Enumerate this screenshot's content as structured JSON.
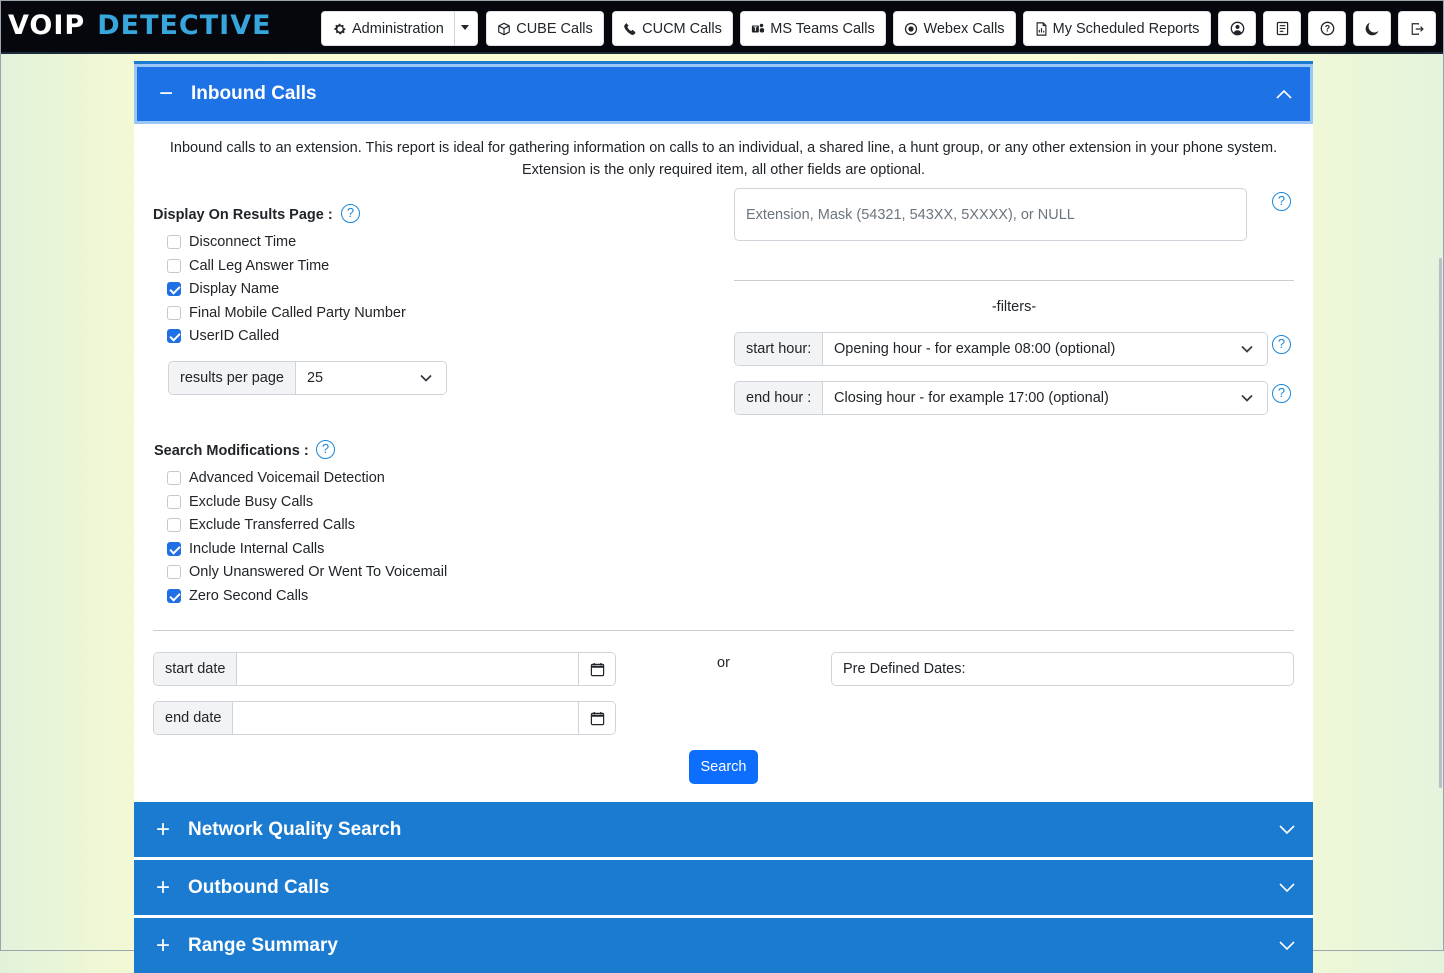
{
  "navbar": {
    "logo_voip": "VOIP",
    "logo_detective": "DETECTIVE",
    "administration": "Administration",
    "cube_calls": "CUBE Calls",
    "cucm_calls": "CUCM Calls",
    "ms_teams_calls": "MS Teams Calls",
    "webex_calls": "Webex Calls",
    "scheduled_reports": "My Scheduled Reports",
    "icon_names": [
      "gear-icon",
      "cube-icon",
      "phone-icon",
      "teams-icon",
      "webex-icon",
      "report-icon",
      "user-icon",
      "notes-icon",
      "help-icon",
      "moon-icon",
      "logout-icon"
    ]
  },
  "inbound": {
    "sign": "−",
    "title": "Inbound Calls",
    "description_line1": "Inbound calls to an extension. This report is ideal for gathering information on calls to an individual, a shared line, a hunt group, or any other extension in your phone system.",
    "description_line2": "Extension is the only required item, all other fields are optional.",
    "display_label": "Display On Results Page :",
    "help_glyph": "?",
    "display_options": [
      {
        "label": "Disconnect Time",
        "checked": false
      },
      {
        "label": "Call Leg Answer Time",
        "checked": false
      },
      {
        "label": "Display Name",
        "checked": true
      },
      {
        "label": "Final Mobile Called Party Number",
        "checked": false
      },
      {
        "label": "UserID Called",
        "checked": true
      }
    ],
    "results_per_page_label": "results per page",
    "results_per_page_value": "25",
    "search_mod_label": "Search Modifications :",
    "search_mods": [
      {
        "label": "Advanced Voicemail Detection",
        "checked": false
      },
      {
        "label": "Exclude Busy Calls",
        "checked": false
      },
      {
        "label": "Exclude Transferred Calls",
        "checked": false
      },
      {
        "label": "Include Internal Calls",
        "checked": true
      },
      {
        "label": "Only Unanswered Or Went To Voicemail",
        "checked": false
      },
      {
        "label": "Zero Second Calls",
        "checked": true
      }
    ],
    "extension_placeholder": "Extension, Mask (54321, 543XX, 5XXXX), or NULL",
    "filters_label": "-filters-",
    "start_hour_label": "start hour:",
    "start_hour_value": "Opening hour - for example 08:00 (optional)",
    "end_hour_label": "end hour :",
    "end_hour_value": "Closing hour - for example 17:00 (optional)",
    "start_date_label": "start date",
    "end_date_label": "end date",
    "or_label": "or",
    "predefined_dates": "Pre Defined Dates:",
    "search_button": "Search"
  },
  "sections": [
    {
      "sign": "+",
      "title": "Network Quality Search"
    },
    {
      "sign": "+",
      "title": "Outbound Calls"
    },
    {
      "sign": "+",
      "title": "Range Summary"
    }
  ],
  "colors": {
    "accordion_active": "#1d72e6",
    "accordion": "#1a7bd0",
    "checkbox_on": "#1f6fe5",
    "button_primary": "#0d6efd",
    "logo_accent": "#36a6dc"
  }
}
